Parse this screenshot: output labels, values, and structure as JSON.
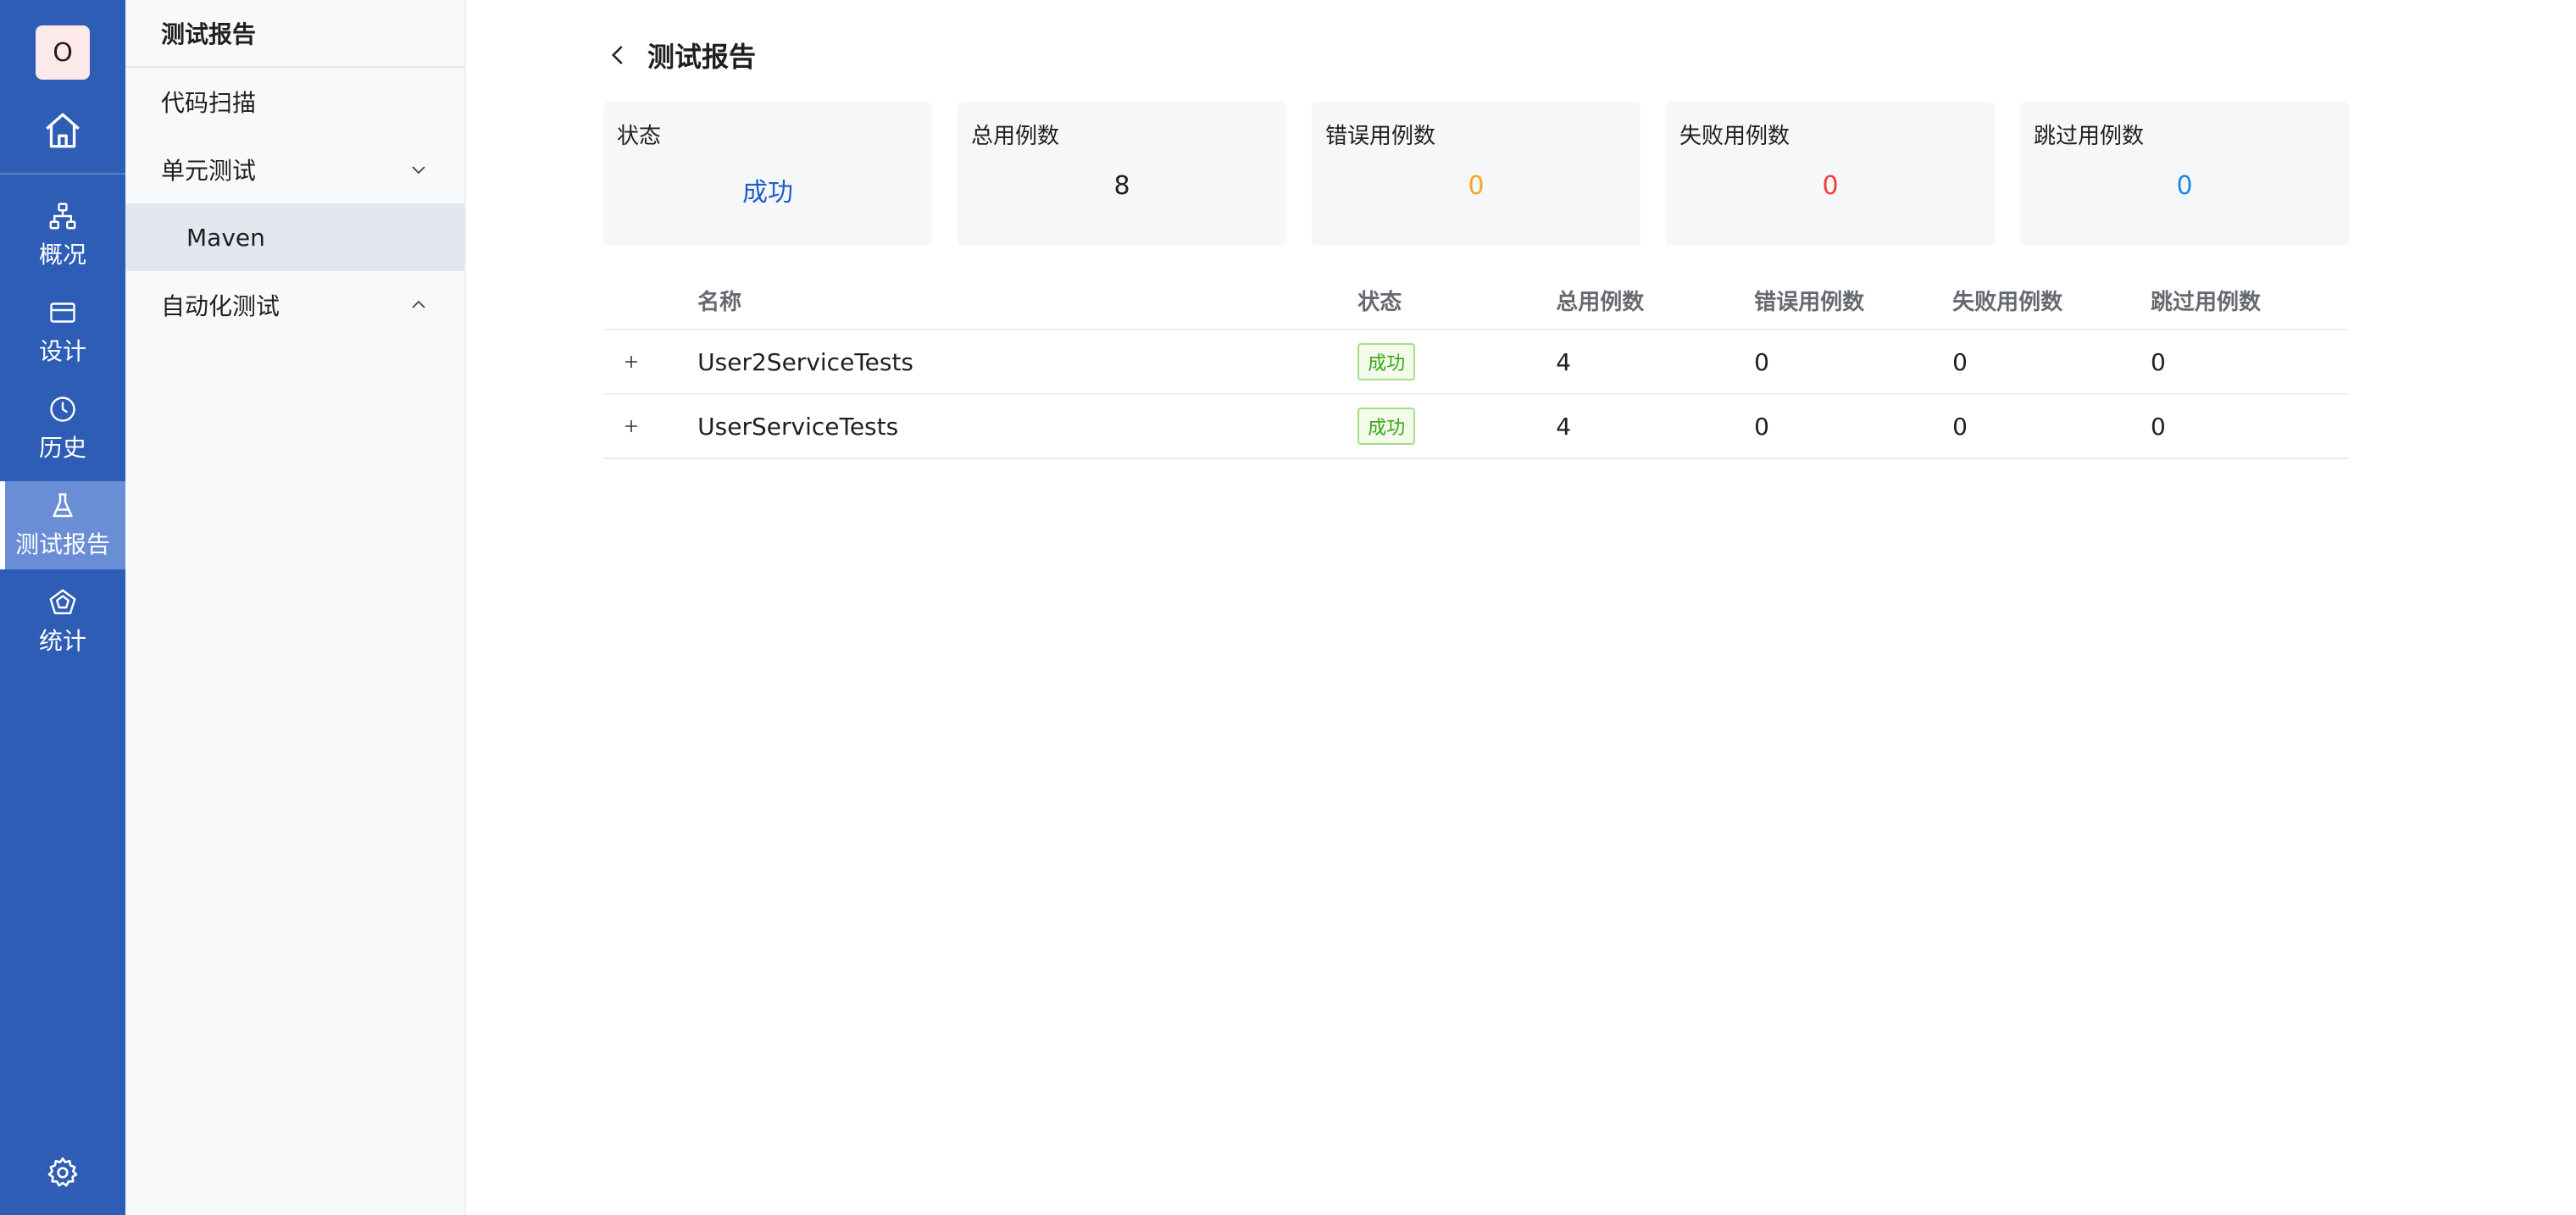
{
  "rail": {
    "avatar_text": "O",
    "items": [
      {
        "label": "概况",
        "icon": "sitemap-icon"
      },
      {
        "label": "设计",
        "icon": "card-icon"
      },
      {
        "label": "历史",
        "icon": "clock-icon"
      },
      {
        "label": "测试报告",
        "icon": "flask-icon"
      },
      {
        "label": "统计",
        "icon": "pentagon-chart-icon"
      }
    ],
    "active_index": 3,
    "colors": {
      "background": "#2e5db5",
      "active": "#6a8ed6"
    }
  },
  "subnav": {
    "title": "测试报告",
    "items": [
      {
        "label": "代码扫描"
      },
      {
        "label": "单元测试",
        "chevron": "down"
      },
      {
        "label": "Maven",
        "selected": true
      },
      {
        "label": "自动化测试",
        "chevron": "up"
      }
    ]
  },
  "page": {
    "title": "测试报告"
  },
  "stats": [
    {
      "label": "状态",
      "value": "成功",
      "color": "#1f5fc9"
    },
    {
      "label": "总用例数",
      "value": "8",
      "color": "#1f1f1f"
    },
    {
      "label": "错误用例数",
      "value": "0",
      "color": "#f5a623"
    },
    {
      "label": "失败用例数",
      "value": "0",
      "color": "#f04134"
    },
    {
      "label": "跳过用例数",
      "value": "0",
      "color": "#1e88e5"
    }
  ],
  "table": {
    "columns": [
      "名称",
      "状态",
      "总用例数",
      "错误用例数",
      "失败用例数",
      "跳过用例数"
    ],
    "rows": [
      {
        "name": "User2ServiceTests",
        "status": "成功",
        "total": "4",
        "error": "0",
        "failed": "0",
        "skipped": "0"
      },
      {
        "name": "UserServiceTests",
        "status": "成功",
        "total": "4",
        "error": "0",
        "failed": "0",
        "skipped": "0"
      }
    ]
  }
}
